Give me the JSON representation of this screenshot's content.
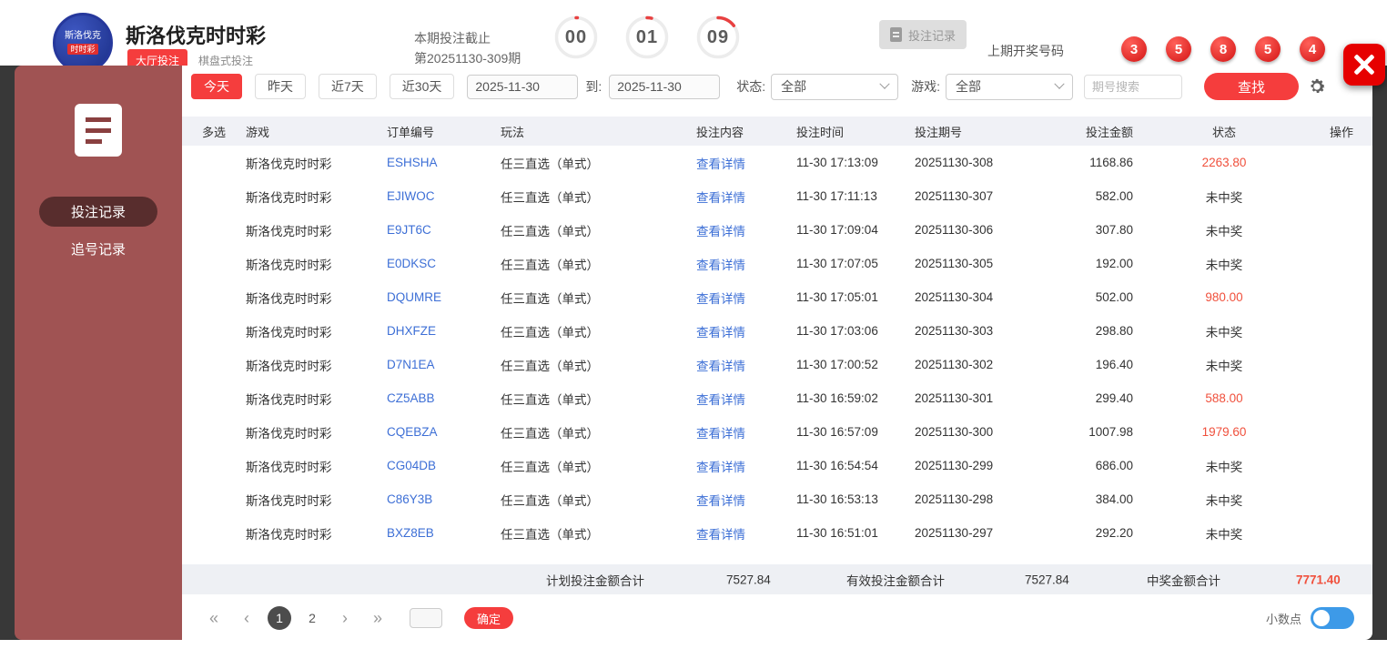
{
  "header": {
    "logo_line1": "斯洛伐克",
    "logo_line2": "时时彩",
    "title": "斯洛伐克时时彩",
    "tab_primary": "大厅投注",
    "tab_secondary": "棋盘式投注",
    "deadline_label": "本期投注截止",
    "deadline_period": "第20251130-309期",
    "countdown": [
      "00",
      "01",
      "09"
    ],
    "records_button_label": "投注记录",
    "last_draw_label": "上期开奖号码",
    "last_draw_numbers": [
      "3",
      "5",
      "8",
      "5",
      "4"
    ]
  },
  "sidebar": {
    "items": [
      {
        "label": "投注记录",
        "active": true
      },
      {
        "label": "追号记录",
        "active": false
      }
    ]
  },
  "filters": {
    "quick": [
      "今天",
      "昨天",
      "近7天",
      "近30天"
    ],
    "active_quick": "今天",
    "date_from": "2025-11-30",
    "to_label": "到:",
    "date_to": "2025-11-30",
    "status_label": "状态:",
    "status_value": "全部",
    "game_label": "游戏:",
    "game_value": "全部",
    "search_placeholder": "期号搜索",
    "search_button_label": "查找"
  },
  "table": {
    "headers": [
      "多选",
      "游戏",
      "订单编号",
      "玩法",
      "投注内容",
      "投注时间",
      "投注期号",
      "投注金额",
      "状态",
      "操作"
    ],
    "rows": [
      {
        "game": "斯洛伐克时时彩",
        "order": "ESHSHA",
        "play": "任三直选（单式）",
        "content": "查看详情",
        "time": "11-30 17:13:09",
        "period": "20251130-308",
        "amount": "1168.86",
        "status": "2263.80",
        "win": true
      },
      {
        "game": "斯洛伐克时时彩",
        "order": "EJIWOC",
        "play": "任三直选（单式）",
        "content": "查看详情",
        "time": "11-30 17:11:13",
        "period": "20251130-307",
        "amount": "582.00",
        "status": "未中奖",
        "win": false
      },
      {
        "game": "斯洛伐克时时彩",
        "order": "E9JT6C",
        "play": "任三直选（单式）",
        "content": "查看详情",
        "time": "11-30 17:09:04",
        "period": "20251130-306",
        "amount": "307.80",
        "status": "未中奖",
        "win": false
      },
      {
        "game": "斯洛伐克时时彩",
        "order": "E0DKSC",
        "play": "任三直选（单式）",
        "content": "查看详情",
        "time": "11-30 17:07:05",
        "period": "20251130-305",
        "amount": "192.00",
        "status": "未中奖",
        "win": false
      },
      {
        "game": "斯洛伐克时时彩",
        "order": "DQUMRE",
        "play": "任三直选（单式）",
        "content": "查看详情",
        "time": "11-30 17:05:01",
        "period": "20251130-304",
        "amount": "502.00",
        "status": "980.00",
        "win": true
      },
      {
        "game": "斯洛伐克时时彩",
        "order": "DHXFZE",
        "play": "任三直选（单式）",
        "content": "查看详情",
        "time": "11-30 17:03:06",
        "period": "20251130-303",
        "amount": "298.80",
        "status": "未中奖",
        "win": false
      },
      {
        "game": "斯洛伐克时时彩",
        "order": "D7N1EA",
        "play": "任三直选（单式）",
        "content": "查看详情",
        "time": "11-30 17:00:52",
        "period": "20251130-302",
        "amount": "196.40",
        "status": "未中奖",
        "win": false
      },
      {
        "game": "斯洛伐克时时彩",
        "order": "CZ5ABB",
        "play": "任三直选（单式）",
        "content": "查看详情",
        "time": "11-30 16:59:02",
        "period": "20251130-301",
        "amount": "299.40",
        "status": "588.00",
        "win": true
      },
      {
        "game": "斯洛伐克时时彩",
        "order": "CQEBZA",
        "play": "任三直选（单式）",
        "content": "查看详情",
        "time": "11-30 16:57:09",
        "period": "20251130-300",
        "amount": "1007.98",
        "status": "1979.60",
        "win": true
      },
      {
        "game": "斯洛伐克时时彩",
        "order": "CG04DB",
        "play": "任三直选（单式）",
        "content": "查看详情",
        "time": "11-30 16:54:54",
        "period": "20251130-299",
        "amount": "686.00",
        "status": "未中奖",
        "win": false
      },
      {
        "game": "斯洛伐克时时彩",
        "order": "C86Y3B",
        "play": "任三直选（单式）",
        "content": "查看详情",
        "time": "11-30 16:53:13",
        "period": "20251130-298",
        "amount": "384.00",
        "status": "未中奖",
        "win": false
      },
      {
        "game": "斯洛伐克时时彩",
        "order": "BXZ8EB",
        "play": "任三直选（单式）",
        "content": "查看详情",
        "time": "11-30 16:51:01",
        "period": "20251130-297",
        "amount": "292.20",
        "status": "未中奖",
        "win": false
      }
    ]
  },
  "summary": {
    "planned_label": "计划投注金额合计",
    "planned_value": "7527.84",
    "valid_label": "有效投注金额合计",
    "valid_value": "7527.84",
    "win_label": "中奖金额合计",
    "win_value": "7771.40"
  },
  "pagination": {
    "pages": [
      "1",
      "2"
    ],
    "active_page": "1",
    "confirm_label": "确定",
    "decimal_label": "小数点",
    "decimal_toggle_on": true
  },
  "colors": {
    "accent_red": "#f53d3d",
    "link_blue": "#3d6fd6",
    "win_red": "#f0503c",
    "sidebar_maroon": "#a05353",
    "toggle_blue": "#3d9ae8",
    "close_red": "#e60000"
  }
}
